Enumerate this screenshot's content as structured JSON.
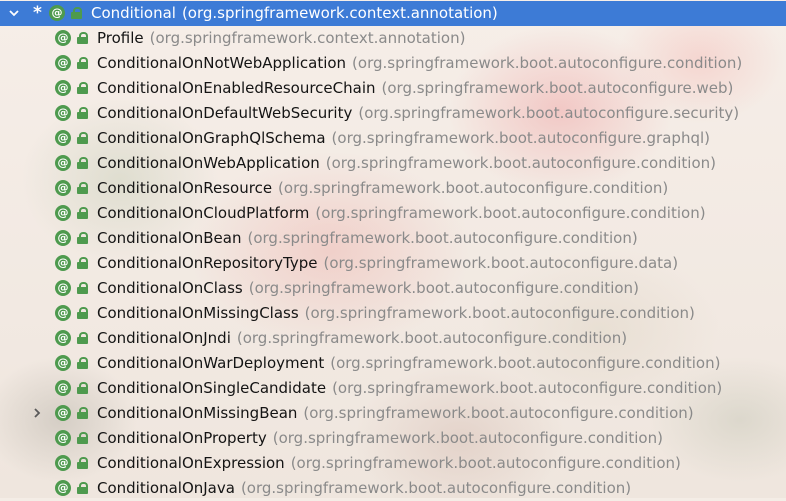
{
  "icons": {
    "annotation_glyph": "@"
  },
  "colors": {
    "selection": "#3d7bd6",
    "annotation_icon": "#4e9a4e",
    "package_text": "#8a8a8a"
  },
  "tree": {
    "root": {
      "name": "Conditional",
      "package": "(org.springframework.context.annotation)",
      "marker": "*",
      "expanded": true
    },
    "items": [
      {
        "name": "Profile",
        "package": "(org.springframework.context.annotation)"
      },
      {
        "name": "ConditionalOnNotWebApplication",
        "package": "(org.springframework.boot.autoconfigure.condition)"
      },
      {
        "name": "ConditionalOnEnabledResourceChain",
        "package": "(org.springframework.boot.autoconfigure.web)"
      },
      {
        "name": "ConditionalOnDefaultWebSecurity",
        "package": "(org.springframework.boot.autoconfigure.security)"
      },
      {
        "name": "ConditionalOnGraphQlSchema",
        "package": "(org.springframework.boot.autoconfigure.graphql)"
      },
      {
        "name": "ConditionalOnWebApplication",
        "package": "(org.springframework.boot.autoconfigure.condition)"
      },
      {
        "name": "ConditionalOnResource",
        "package": "(org.springframework.boot.autoconfigure.condition)"
      },
      {
        "name": "ConditionalOnCloudPlatform",
        "package": "(org.springframework.boot.autoconfigure.condition)"
      },
      {
        "name": "ConditionalOnBean",
        "package": "(org.springframework.boot.autoconfigure.condition)"
      },
      {
        "name": "ConditionalOnRepositoryType",
        "package": "(org.springframework.boot.autoconfigure.data)"
      },
      {
        "name": "ConditionalOnClass",
        "package": "(org.springframework.boot.autoconfigure.condition)"
      },
      {
        "name": "ConditionalOnMissingClass",
        "package": "(org.springframework.boot.autoconfigure.condition)"
      },
      {
        "name": "ConditionalOnJndi",
        "package": "(org.springframework.boot.autoconfigure.condition)"
      },
      {
        "name": "ConditionalOnWarDeployment",
        "package": "(org.springframework.boot.autoconfigure.condition)"
      },
      {
        "name": "ConditionalOnSingleCandidate",
        "package": "(org.springframework.boot.autoconfigure.condition)"
      },
      {
        "name": "ConditionalOnMissingBean",
        "package": "(org.springframework.boot.autoconfigure.condition)",
        "expandable": true
      },
      {
        "name": "ConditionalOnProperty",
        "package": "(org.springframework.boot.autoconfigure.condition)"
      },
      {
        "name": "ConditionalOnExpression",
        "package": "(org.springframework.boot.autoconfigure.condition)"
      },
      {
        "name": "ConditionalOnJava",
        "package": "(org.springframework.boot.autoconfigure.condition)"
      }
    ]
  }
}
